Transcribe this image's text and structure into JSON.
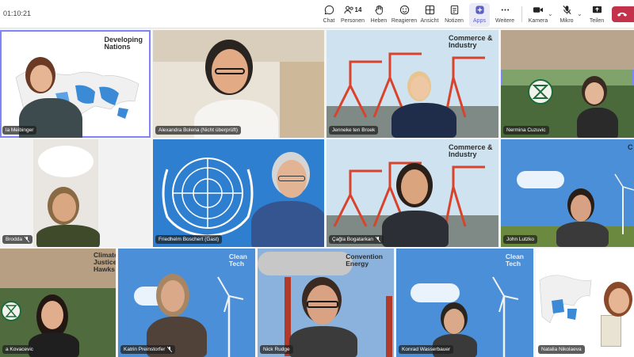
{
  "meeting": {
    "timer": "01:10:21"
  },
  "toolbar": {
    "chat": "Chat",
    "people": "Personen",
    "people_count": "14",
    "raise": "Heben",
    "react": "Reagieren",
    "view": "Ansicht",
    "notes": "Notizen",
    "apps": "Apps",
    "more": "Weitere",
    "camera": "Kamera",
    "mic": "Mikro",
    "share": "Teilen"
  },
  "colors": {
    "accent": "#5b5fc7",
    "leave": "#c4314b",
    "speaking_border": "#7f85f5"
  },
  "participants": [
    {
      "name": "la Meibinger",
      "background_label": "Developing\nNations",
      "muted": false
    },
    {
      "name": "Alexandra Bolena (Nicht überprüft)",
      "background_label": "",
      "muted": false
    },
    {
      "name": "Jenneke ten Broek",
      "background_label": "Commerce &\nIndustry",
      "muted": false
    },
    {
      "name": "Nermina Cuzuvic",
      "background_label": "",
      "muted": false
    },
    {
      "name": "Brodda",
      "background_label": "",
      "muted": true
    },
    {
      "name": "Friedhelm Boschert (Gast)",
      "background_label": "",
      "muted": false
    },
    {
      "name": "Çağla Bogatarkan",
      "background_label": "Commerce &\nIndustry",
      "muted": true
    },
    {
      "name": "John Lutzko",
      "background_label": "C",
      "muted": false
    },
    {
      "name": "a Kovacevic",
      "background_label": "Climate\nJustice\nHawks",
      "muted": false
    },
    {
      "name": "Katrin Preinstorfer",
      "background_label": "Clean\nTech",
      "muted": true
    },
    {
      "name": "Nick Rudge",
      "background_label": "Convention\nEnergy",
      "muted": false
    },
    {
      "name": "Konrad Wasserbauer",
      "background_label": "Clean\nTech",
      "muted": false
    },
    {
      "name": "Natalia Nikolaeva",
      "background_label": "",
      "muted": false
    }
  ]
}
